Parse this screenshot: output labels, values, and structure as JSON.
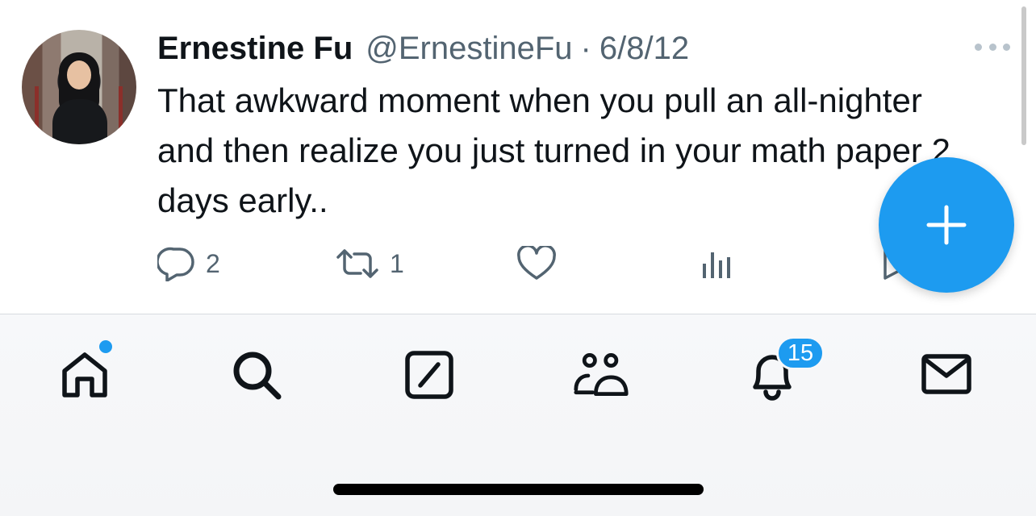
{
  "tweet": {
    "author_name": "Ernestine Fu",
    "author_handle": "@ErnestineFu",
    "separator": "·",
    "date": "6/8/12",
    "text": "That awkward moment when you pull an all-nighter and then realize you just turned in your math paper 2 days early..",
    "reply_count": "2",
    "retweet_count": "1"
  },
  "nav": {
    "notifications_badge": "15",
    "items": [
      "home-icon",
      "search-icon",
      "grok-icon",
      "communities-icon",
      "notifications-icon",
      "messages-icon"
    ]
  },
  "colors": {
    "accent": "#1d9bf0",
    "text_primary": "#0f1419",
    "text_secondary": "#536471"
  }
}
